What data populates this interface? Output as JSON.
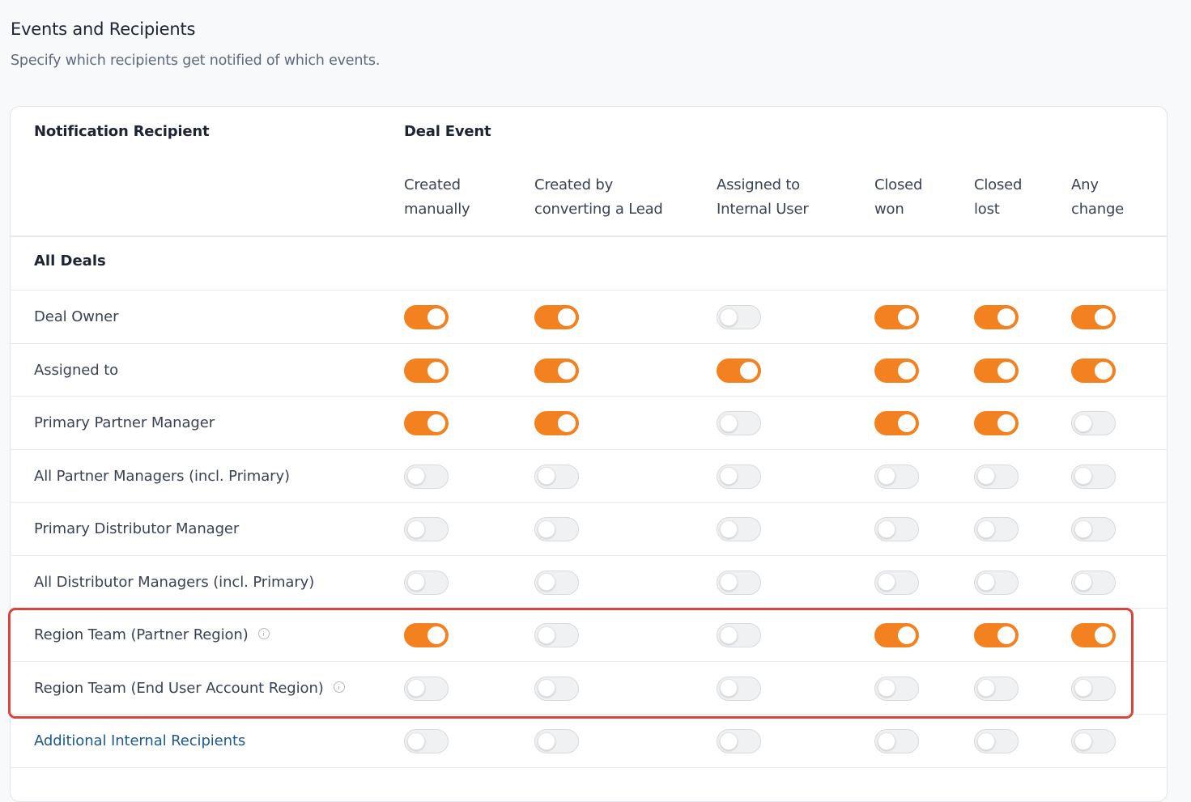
{
  "section": {
    "title": "Events and Recipients",
    "subtitle": "Specify which recipients get notified of which events."
  },
  "table": {
    "recipient_header": "Notification Recipient",
    "event_header": "Deal Event",
    "columns": [
      {
        "line1": "Created",
        "line2": "manually"
      },
      {
        "line1": "Created by",
        "line2": "converting a Lead"
      },
      {
        "line1": "Assigned to",
        "line2": "Internal User"
      },
      {
        "line1": "Closed",
        "line2": "won"
      },
      {
        "line1": "Closed",
        "line2": "lost"
      },
      {
        "line1": "Any",
        "line2": "change"
      }
    ],
    "group_label": "All Deals",
    "rows": [
      {
        "label": "Deal Owner",
        "toggles": [
          true,
          true,
          false,
          true,
          true,
          true
        ]
      },
      {
        "label": "Assigned to",
        "toggles": [
          true,
          true,
          true,
          true,
          true,
          true
        ]
      },
      {
        "label": "Primary Partner Manager",
        "toggles": [
          true,
          true,
          false,
          true,
          true,
          false
        ]
      },
      {
        "label": "All Partner Managers (incl. Primary)",
        "toggles": [
          false,
          false,
          false,
          false,
          false,
          false
        ]
      },
      {
        "label": "Primary Distributor Manager",
        "toggles": [
          false,
          false,
          false,
          false,
          false,
          false
        ]
      },
      {
        "label": "All Distributor Managers (incl. Primary)",
        "toggles": [
          false,
          false,
          false,
          false,
          false,
          false
        ]
      },
      {
        "label": "Region Team (Partner Region)",
        "info": true,
        "toggles": [
          true,
          false,
          false,
          true,
          true,
          true
        ]
      },
      {
        "label": "Region Team (End User Account Region)",
        "info": true,
        "toggles": [
          false,
          false,
          false,
          false,
          false,
          false
        ]
      },
      {
        "label": "Additional Internal Recipients",
        "link": true,
        "toggles": [
          false,
          false,
          false,
          false,
          false,
          false
        ]
      }
    ]
  },
  "colors": {
    "toggle_on": "#f38120",
    "toggle_off": "#f0f1f3",
    "highlight": "#d9453a",
    "link": "#1b5a8a"
  }
}
